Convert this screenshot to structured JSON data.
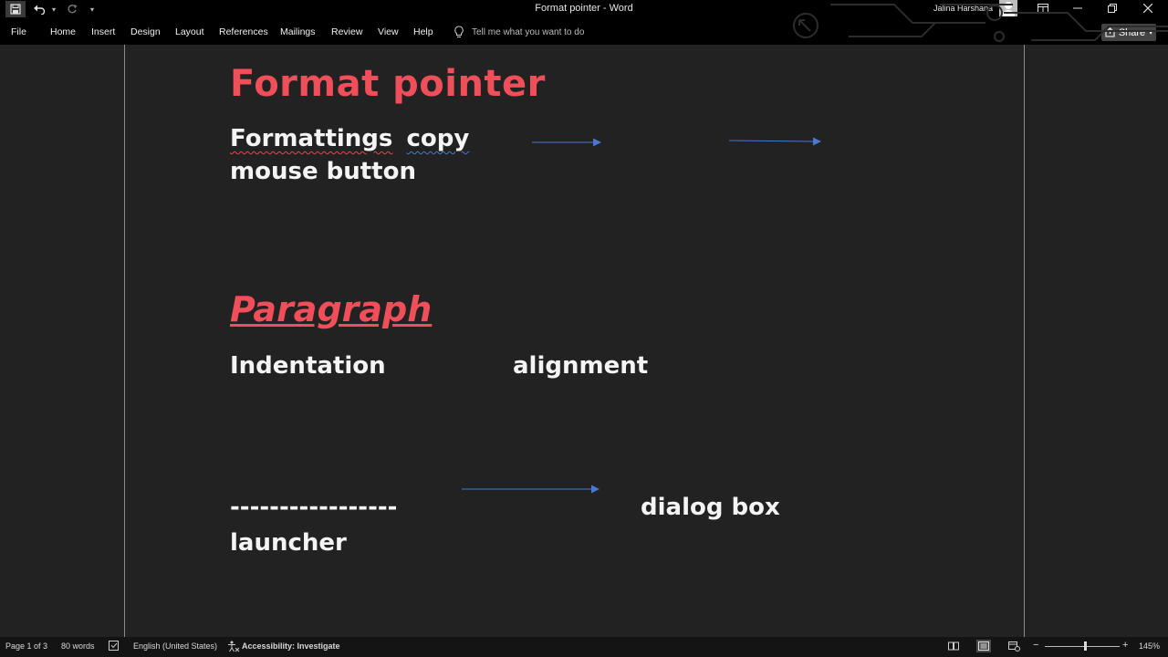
{
  "window": {
    "title": "Format pointer  -  Word",
    "user": "Jalina Harshana"
  },
  "ribbon": {
    "tabs": [
      "File",
      "Home",
      "Insert",
      "Design",
      "Layout",
      "References",
      "Mailings",
      "Review",
      "View",
      "Help"
    ],
    "tell_me_placeholder": "Tell me what you want to do",
    "share_label": "Share"
  },
  "document": {
    "heading1": "Format pointer",
    "line1_word1": "Formattings",
    "line1_word2": "copy",
    "line2": "mouse button",
    "heading2": "Paragraph",
    "indentation": "Indentation",
    "alignment": "alignment",
    "dashes": "-----------------",
    "dialog_box": "dialog box",
    "launcher": "launcher"
  },
  "status": {
    "page": "Page 1 of 3",
    "words": "80 words",
    "language": "English (United States)",
    "accessibility": "Accessibility: Investigate",
    "zoom": "145%"
  },
  "colors": {
    "heading_red": "#f04f5a",
    "arrow_blue": "#4a78d0",
    "titlebar_bg": "#000000",
    "canvas_bg": "#222222"
  },
  "icons": {
    "save": "save-icon",
    "undo": "undo-icon",
    "redo": "redo-icon",
    "tell_me": "lightbulb-icon",
    "share": "share-icon"
  }
}
